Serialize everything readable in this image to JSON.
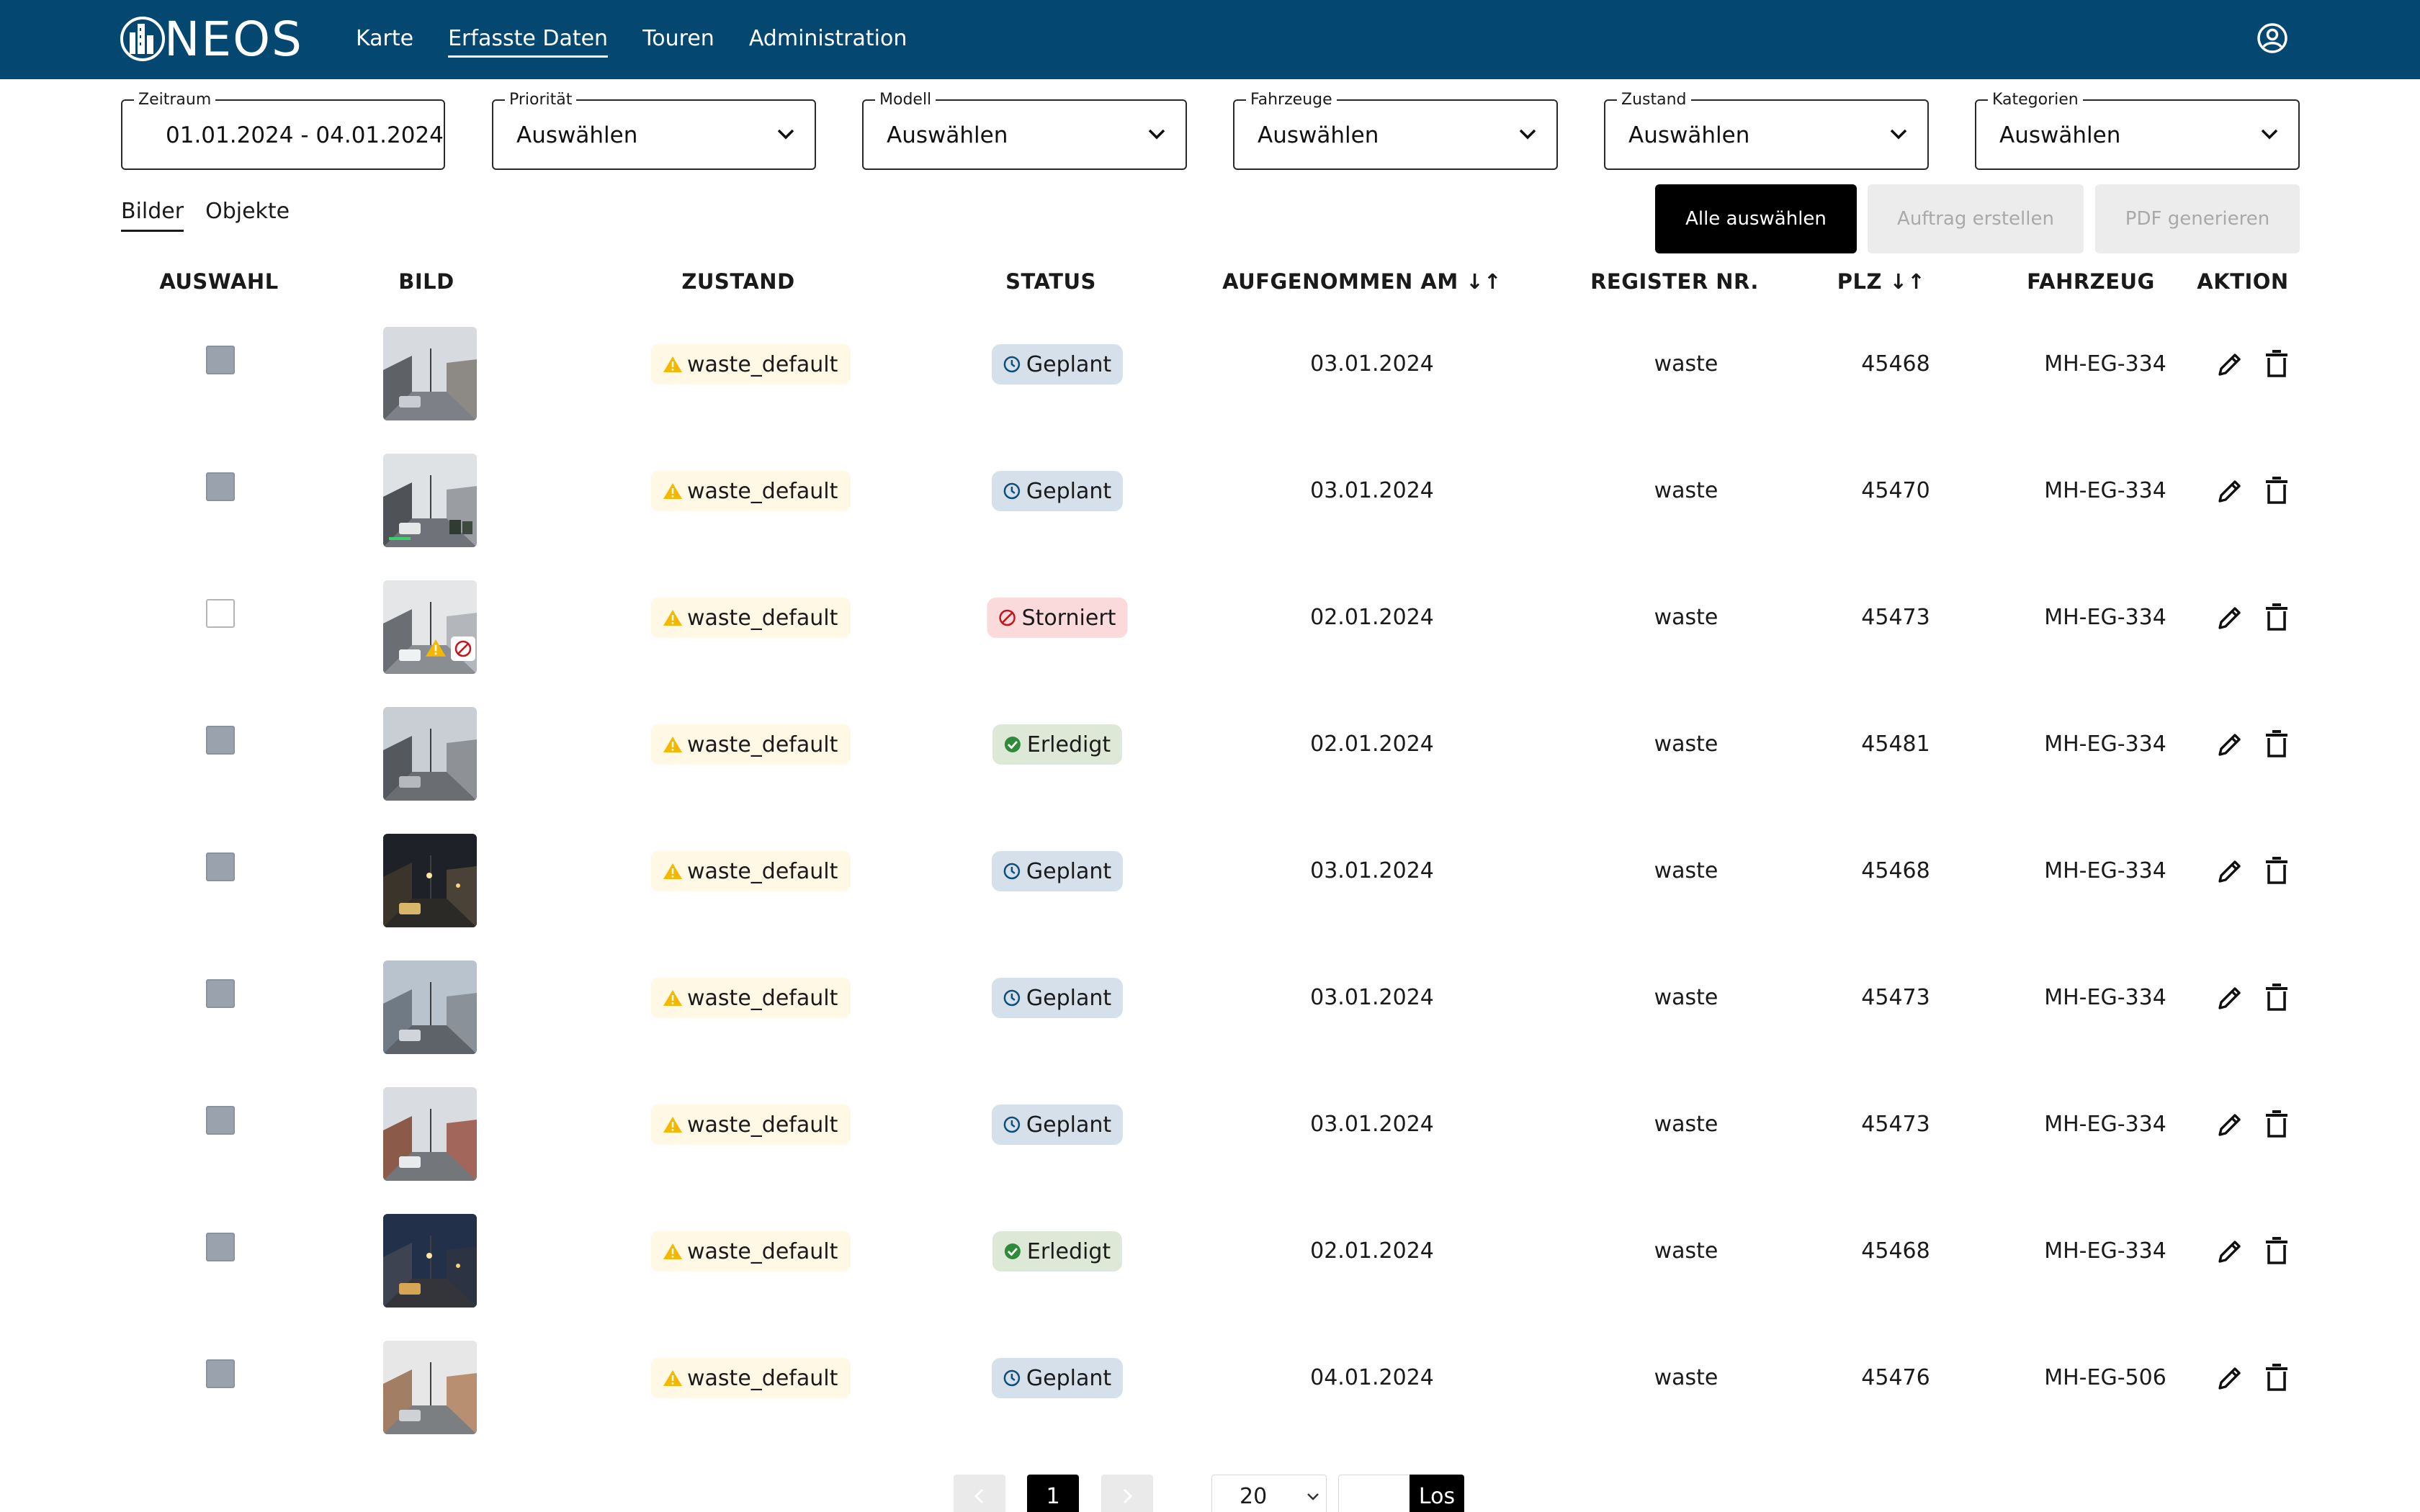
{
  "header": {
    "logo_text": "NEOS",
    "nav": [
      {
        "label": "Karte",
        "active": false
      },
      {
        "label": "Erfasste Daten",
        "active": true
      },
      {
        "label": "Touren",
        "active": false
      },
      {
        "label": "Administration",
        "active": false
      }
    ],
    "profile_icon": "account-circle-icon"
  },
  "filters": [
    {
      "label": "Zeitraum",
      "value": "01.01.2024 - 04.01.2024",
      "dropdown": false
    },
    {
      "label": "Priorität",
      "value": "Auswählen",
      "dropdown": true
    },
    {
      "label": "Modell",
      "value": "Auswählen",
      "dropdown": true
    },
    {
      "label": "Fahrzeuge",
      "value": "Auswählen",
      "dropdown": true
    },
    {
      "label": "Zustand",
      "value": "Auswählen",
      "dropdown": true
    },
    {
      "label": "Kategorien",
      "value": "Auswählen",
      "dropdown": true
    }
  ],
  "tabs": [
    {
      "label": "Bilder",
      "active": true
    },
    {
      "label": "Objekte",
      "active": false
    }
  ],
  "actions": {
    "select_all": "Alle auswählen",
    "create_order": "Auftrag erstellen",
    "generate_pdf": "PDF generieren"
  },
  "table": {
    "columns": [
      "AUSWAHL",
      "BILD",
      "ZUSTAND",
      "STATUS",
      "AUFGENOMMEN AM ↓↑",
      "REGISTER NR.",
      "PLZ ↓↑",
      "FAHRZEUG",
      "AKTION"
    ],
    "rows": [
      {
        "checked": true,
        "thumb": "street-day",
        "zustand": "waste_default",
        "status": "Geplant",
        "status_kind": "geplant",
        "date": "03.01.2024",
        "register": "waste",
        "plz": "45468",
        "vehicle": "MH-EG-334"
      },
      {
        "checked": true,
        "thumb": "street-bins",
        "zustand": "waste_default",
        "status": "Geplant",
        "status_kind": "geplant",
        "date": "03.01.2024",
        "register": "waste",
        "plz": "45470",
        "vehicle": "MH-EG-334"
      },
      {
        "checked": false,
        "thumb": "street-flagged",
        "zustand": "waste_default",
        "status": "Storniert",
        "status_kind": "storniert",
        "date": "02.01.2024",
        "register": "waste",
        "plz": "45473",
        "vehicle": "MH-EG-334"
      },
      {
        "checked": true,
        "thumb": "street-rain",
        "zustand": "waste_default",
        "status": "Erledigt",
        "status_kind": "erledigt",
        "date": "02.01.2024",
        "register": "waste",
        "plz": "45481",
        "vehicle": "MH-EG-334"
      },
      {
        "checked": true,
        "thumb": "street-night",
        "zustand": "waste_default",
        "status": "Geplant",
        "status_kind": "geplant",
        "date": "03.01.2024",
        "register": "waste",
        "plz": "45468",
        "vehicle": "MH-EG-334"
      },
      {
        "checked": true,
        "thumb": "street-wet",
        "zustand": "waste_default",
        "status": "Geplant",
        "status_kind": "geplant",
        "date": "03.01.2024",
        "register": "waste",
        "plz": "45473",
        "vehicle": "MH-EG-334"
      },
      {
        "checked": true,
        "thumb": "street-houses",
        "zustand": "waste_default",
        "status": "Geplant",
        "status_kind": "geplant",
        "date": "03.01.2024",
        "register": "waste",
        "plz": "45473",
        "vehicle": "MH-EG-334"
      },
      {
        "checked": true,
        "thumb": "street-dusk",
        "zustand": "waste_default",
        "status": "Erledigt",
        "status_kind": "erledigt",
        "date": "02.01.2024",
        "register": "waste",
        "plz": "45468",
        "vehicle": "MH-EG-334"
      },
      {
        "checked": true,
        "thumb": "street-building",
        "zustand": "waste_default",
        "status": "Geplant",
        "status_kind": "geplant",
        "date": "04.01.2024",
        "register": "waste",
        "plz": "45476",
        "vehicle": "MH-EG-506"
      }
    ]
  },
  "pagination": {
    "current_page": "1",
    "page_size": "20",
    "go_label": "Los"
  },
  "colors": {
    "header_bg": "#044872",
    "geplant": "#d6e0ea",
    "storniert": "#fadada",
    "erledigt": "#dde8d6",
    "warning": "#f5b800"
  }
}
